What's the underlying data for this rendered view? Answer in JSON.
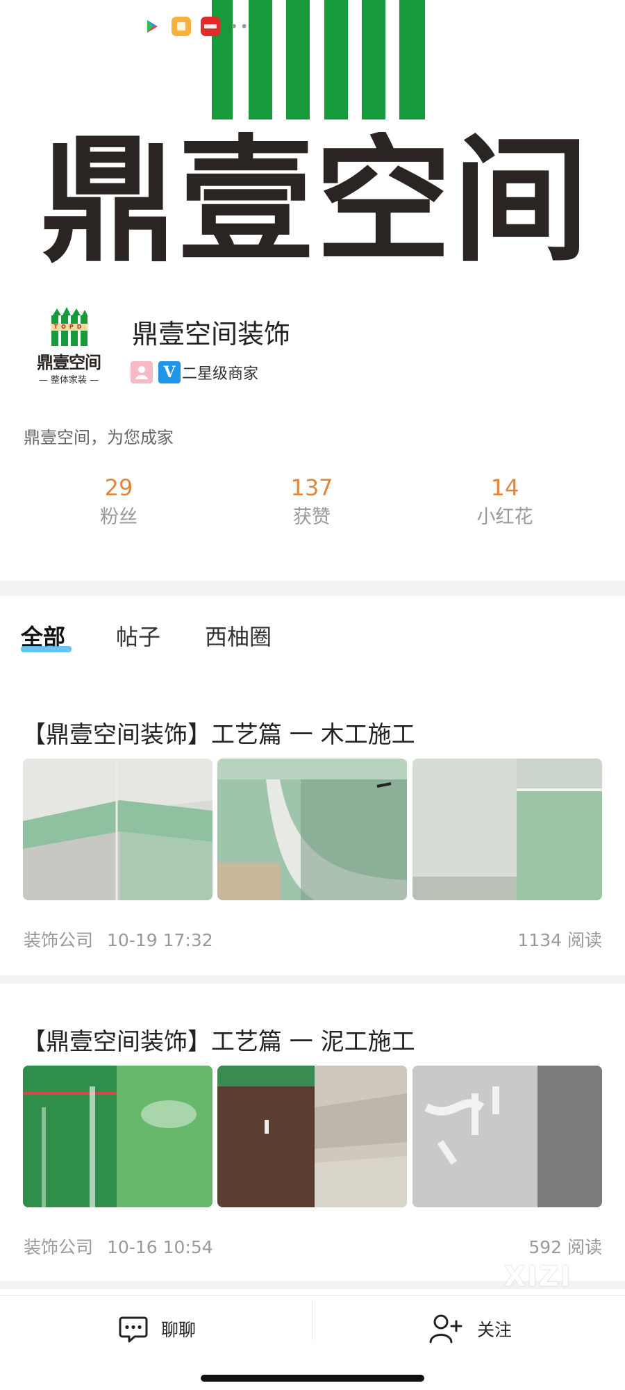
{
  "banner": {
    "brand_text": "鼎壹空间"
  },
  "profile": {
    "avatar_title": "鼎壹空间",
    "avatar_subtitle": "— 整体家装 —",
    "avatar_letters": "TOPD",
    "name": "鼎壹空间装饰",
    "merchant_level": "二星级商家",
    "slogan": "鼎壹空间，为您成家",
    "stats": [
      {
        "value": "29",
        "label": "粉丝"
      },
      {
        "value": "137",
        "label": "获赞"
      },
      {
        "value": "14",
        "label": "小红花"
      }
    ]
  },
  "tabs": [
    {
      "label": "全部",
      "active": true
    },
    {
      "label": "帖子",
      "active": false
    },
    {
      "label": "西柚圈",
      "active": false
    }
  ],
  "posts": [
    {
      "title": "【鼎壹空间装饰】工艺篇 一 木工施工",
      "category": "装饰公司",
      "time": "10-19 17:32",
      "reads": "1134 阅读"
    },
    {
      "title": "【鼎壹空间装饰】工艺篇 一 泥工施工",
      "category": "装饰公司",
      "time": "10-16 10:54",
      "reads": "592 阅读"
    }
  ],
  "bottom_bar": {
    "chat_label": "聊聊",
    "follow_label": "关注"
  },
  "watermark": "XIZI",
  "colors": {
    "accent_orange": "#e4843a",
    "tab_underline": "#4db8ea",
    "brand_green": "#169a3c"
  }
}
